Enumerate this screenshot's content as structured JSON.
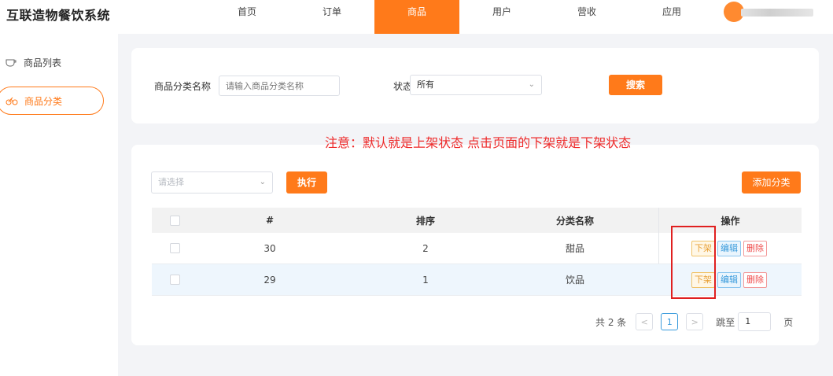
{
  "brand": "互联造物餐饮系统",
  "nav": [
    "首页",
    "订单",
    "商品",
    "用户",
    "营收",
    "应用"
  ],
  "sidebar": [
    {
      "label": "商品列表",
      "icon": "cup-icon"
    },
    {
      "label": "商品分类",
      "icon": "bicycle-icon"
    }
  ],
  "search": {
    "category_label": "商品分类名称",
    "category_placeholder": "请输入商品分类名称",
    "status_label": "状态",
    "status_value": "所有",
    "search_button": "搜索"
  },
  "notice": "注意：默认就是上架状态  点击页面的下架就是下架状态",
  "toolbar": {
    "bulk_placeholder": "请选择",
    "execute_button": "执行",
    "add_button": "添加分类"
  },
  "table": {
    "headers": [
      "#",
      "排序",
      "分类名称",
      "操作"
    ],
    "rows": [
      {
        "id": "30",
        "sort": "2",
        "name": "甜品"
      },
      {
        "id": "29",
        "sort": "1",
        "name": "饮品"
      }
    ],
    "actions": {
      "off": "下架",
      "edit": "编辑",
      "delete": "删除"
    }
  },
  "pagination": {
    "total": "共 2 条",
    "prev": "<",
    "current": "1",
    "next": ">",
    "jump_label": "跳至",
    "jump_value": "1",
    "page_suffix": "页"
  },
  "colors": {
    "accent": "#ff7a1a",
    "notice": "#ee2a2a",
    "highlight": "#e02020"
  }
}
